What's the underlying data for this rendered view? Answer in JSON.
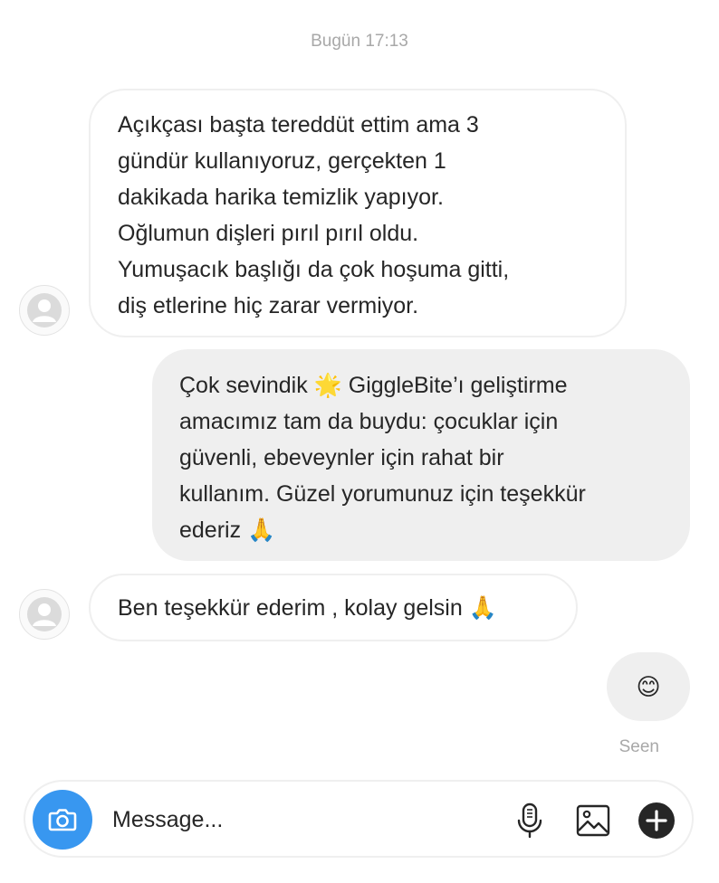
{
  "timestamp": "Bugün 17:13",
  "messages": [
    {
      "direction": "incoming",
      "lines": [
        "Açıkçası başta tereddüt ettim ama 3",
        "gündür kullanıyoruz, gerçekten 1",
        "dakikada harika temizlik yapıyor.",
        "Oğlumun dişleri pırıl pırıl oldu.",
        "Yumuşacık başlığı da çok hoşuma gitti,",
        "diş etlerine hiç zarar vermiyor."
      ]
    },
    {
      "direction": "outgoing",
      "lines": [
        "Çok sevindik 🌟 GiggleBite’ı geliştirme",
        "amacımız tam da buydu: çocuklar için",
        "güvenli, ebeveynler için rahat bir",
        "kullanım. Güzel yorumunuz için teşekkür",
        "ederiz 🙏"
      ]
    },
    {
      "direction": "incoming",
      "lines": [
        "Ben teşekkür ederim , kolay gelsin 🙏"
      ]
    },
    {
      "direction": "outgoing",
      "lines": [
        "😊"
      ]
    }
  ],
  "seen_label": "Seen",
  "composer": {
    "placeholder": "Message...",
    "icons": [
      "camera-icon",
      "microphone-icon",
      "gallery-icon",
      "plus-icon"
    ]
  },
  "colors": {
    "accent": "#3897f0",
    "outgoing_bubble": "#efefef",
    "incoming_border": "#efefef",
    "meta_text": "#a8a8a8"
  }
}
